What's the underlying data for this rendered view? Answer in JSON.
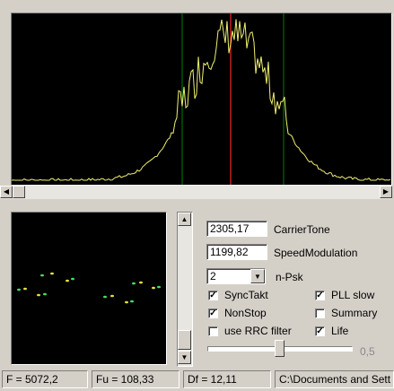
{
  "carrier_tone": {
    "value": "2305,17",
    "label": "CarrierTone"
  },
  "speed_modulation": {
    "value": "1199,82",
    "label": "SpeedModulation"
  },
  "npsk": {
    "selected": "2",
    "label": "n-Psk"
  },
  "checkboxes": {
    "sync_takt": {
      "label": "SyncTakt",
      "checked": true
    },
    "pll_slow": {
      "label": "PLL slow",
      "checked": true
    },
    "non_stop": {
      "label": "NonStop",
      "checked": true
    },
    "summary": {
      "label": "Summary",
      "checked": false
    },
    "use_rrc_filter": {
      "label": "use RRC filter",
      "checked": false
    },
    "life": {
      "label": "Life",
      "checked": true
    }
  },
  "slider": {
    "value_label": "0,5",
    "level": 0.5
  },
  "status": {
    "f": "F = 5072,2",
    "fu": "Fu = 108,33",
    "df": "Df = 12,11",
    "path": "C:\\Documents and Sett"
  },
  "colors": {
    "spectrum_trace": "#f0f070",
    "marker_green": "#008000",
    "marker_red": "#c02020",
    "constellation_green": "#40e060",
    "constellation_yellow": "#e0e040"
  }
}
